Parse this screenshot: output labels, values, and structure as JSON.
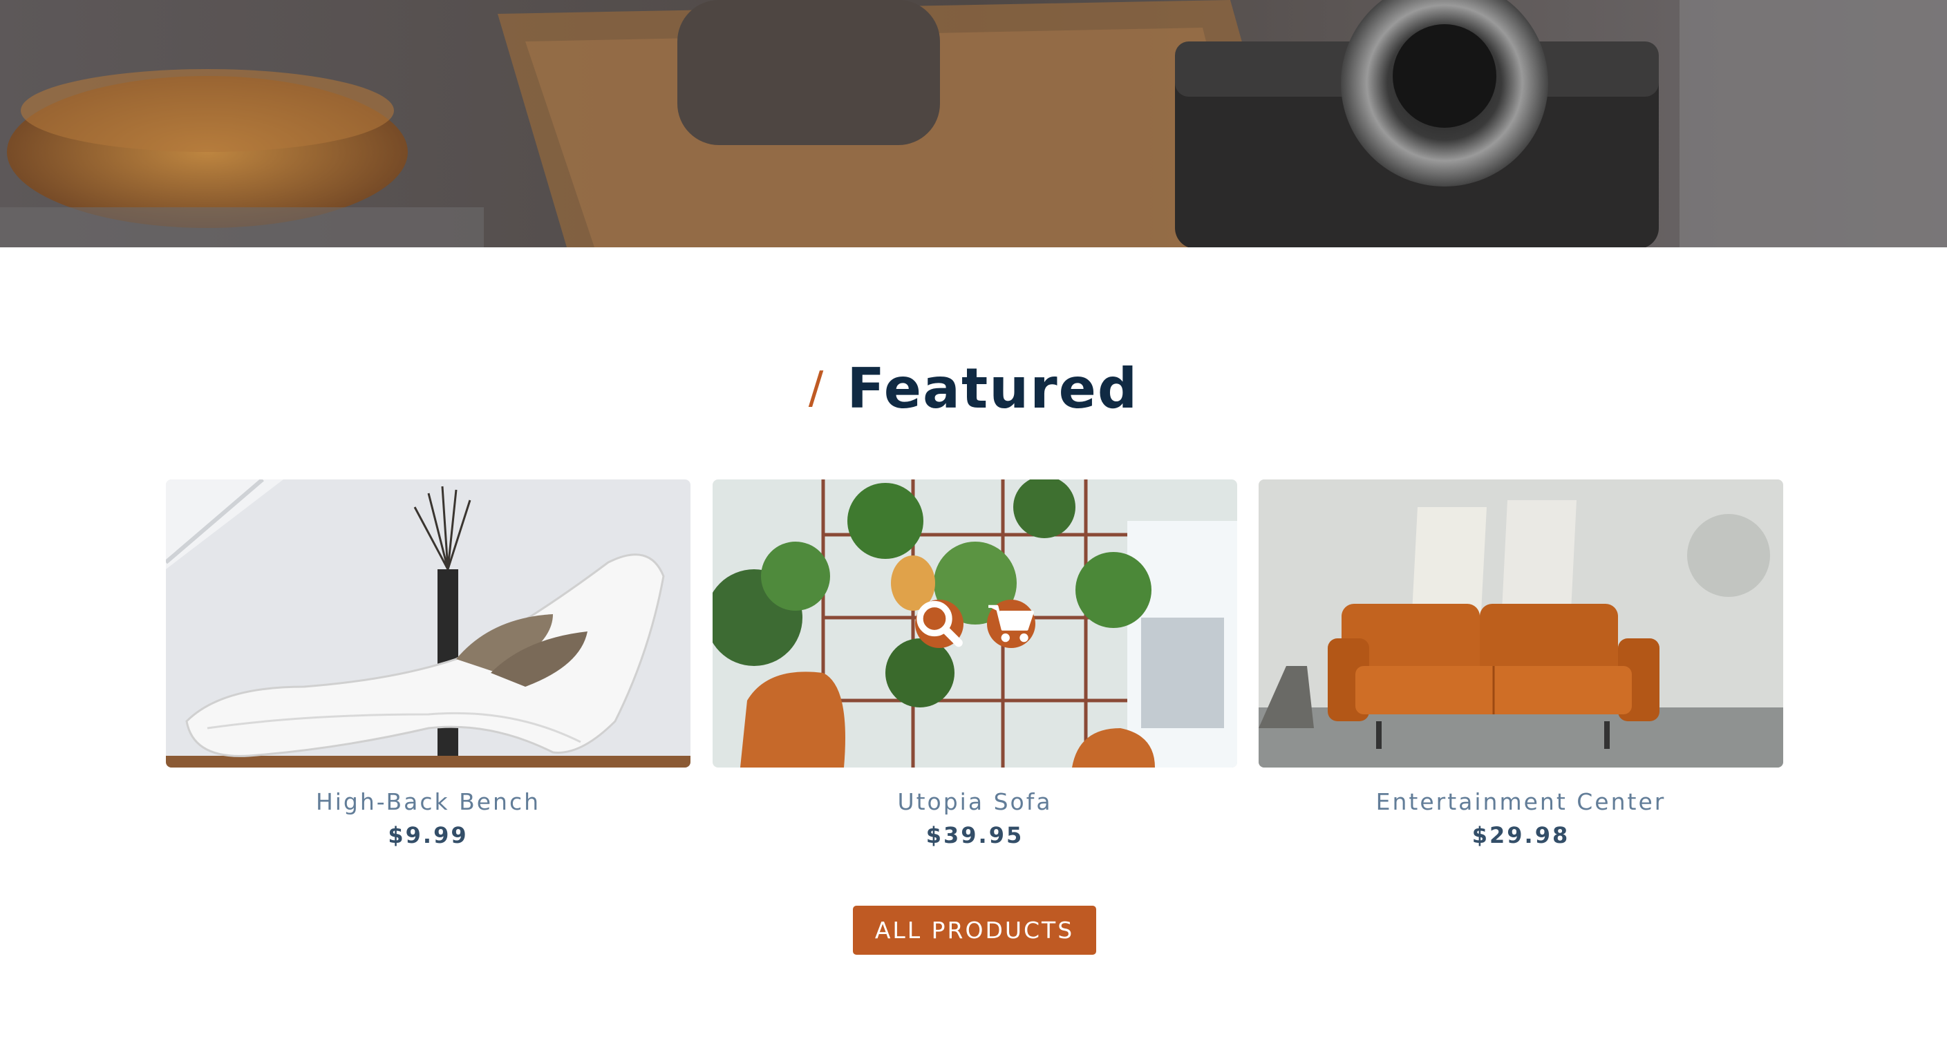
{
  "hero": {
    "image": "desk-with-camera-and-coffee"
  },
  "section": {
    "slash": "/",
    "title": "Featured"
  },
  "products": [
    {
      "name": "High-Back Bench",
      "price": "$9.99",
      "image": "white-chaise-lounge"
    },
    {
      "name": "Utopia Sofa",
      "price": "$39.95",
      "image": "plant-shelf-with-orange-chairs"
    },
    {
      "name": "Entertainment Center",
      "price": "$29.98",
      "image": "orange-leather-sofa"
    }
  ],
  "overlay": {
    "search_icon": "search-icon",
    "cart_icon": "shopping-cart-icon"
  },
  "cta": {
    "label": "ALL PRODUCTS"
  },
  "colors": {
    "accent": "#bf5a23",
    "heading": "#102a43",
    "name": "#627d98",
    "price": "#334e68"
  }
}
